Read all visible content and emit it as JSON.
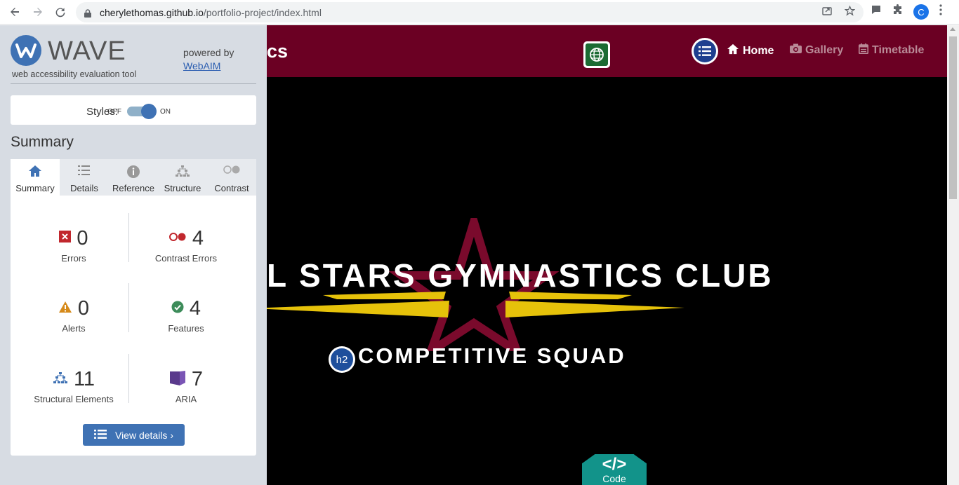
{
  "browser": {
    "url_host": "cherylethomas.github.io",
    "url_path": "/portfolio-project/index.html",
    "profile_initial": "C"
  },
  "wave": {
    "title": "WAVE",
    "subtitle": "web accessibility evaluation tool",
    "powered_by": "powered by",
    "webaim_link": "WebAIM",
    "styles_label": "Styles:",
    "toggle_off": "OFF",
    "toggle_on": "ON",
    "summary_heading": "Summary",
    "tabs": [
      {
        "label": "Summary",
        "icon": "home-icon"
      },
      {
        "label": "Details",
        "icon": "list-icon"
      },
      {
        "label": "Reference",
        "icon": "info-icon"
      },
      {
        "label": "Structure",
        "icon": "hierarchy-icon"
      },
      {
        "label": "Contrast",
        "icon": "contrast-icon"
      }
    ],
    "stats": {
      "errors": {
        "count": "0",
        "label": "Errors"
      },
      "contrast_errors": {
        "count": "4",
        "label": "Contrast Errors"
      },
      "alerts": {
        "count": "0",
        "label": "Alerts"
      },
      "features": {
        "count": "4",
        "label": "Features"
      },
      "structural": {
        "count": "11",
        "label": "Structural Elements"
      },
      "aria": {
        "count": "7",
        "label": "ARIA"
      }
    },
    "view_details": "View details ›",
    "colors": {
      "accent": "#3f72b4",
      "error": "#c1272d",
      "alert": "#d68a1a",
      "feature": "#3d8c5a",
      "aria": "#5a3a8c"
    }
  },
  "site": {
    "brand_fragment": "cs",
    "nav": [
      {
        "label": "Home",
        "icon": "home-icon",
        "active": true
      },
      {
        "label": "Gallery",
        "icon": "camera-icon",
        "active": false
      },
      {
        "label": "Timetable",
        "icon": "calendar-icon",
        "active": false
      }
    ],
    "hero_title": "L STARS GYMNASTICS CLUB",
    "h2_badge": "h2",
    "subtitle": "COMPETITIVE SQUAD",
    "code_badge": "Code",
    "code_glyph": "</>",
    "colors": {
      "header": "#6b0023",
      "star": "#7a0a2c",
      "wings": "#e6c20a"
    }
  }
}
